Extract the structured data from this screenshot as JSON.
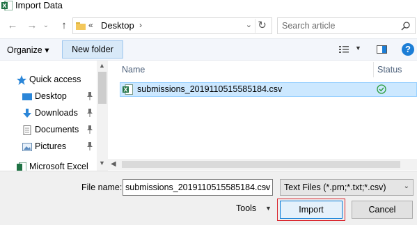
{
  "window": {
    "title": "Import Data",
    "app_icon": "excel-icon"
  },
  "nav": {
    "back_icon": "back-arrow-icon",
    "forward_icon": "forward-arrow-icon",
    "up_icon": "up-arrow-icon",
    "address": {
      "prefix": "«",
      "location": "Desktop",
      "chevron": "›"
    },
    "search_placeholder": "Search article"
  },
  "toolbar": {
    "organize_label": "Organize ▾",
    "new_folder_label": "New folder",
    "help_label": "?"
  },
  "sidebar": {
    "items": [
      {
        "label": "Quick access",
        "icon": "star-icon"
      },
      {
        "label": "Desktop",
        "icon": "desktop-icon",
        "pinned": true
      },
      {
        "label": "Downloads",
        "icon": "download-icon",
        "pinned": true
      },
      {
        "label": "Documents",
        "icon": "documents-icon",
        "pinned": true
      },
      {
        "label": "Pictures",
        "icon": "pictures-icon",
        "pinned": true
      },
      {
        "label": "Microsoft Excel",
        "icon": "excel-icon"
      }
    ]
  },
  "file_list": {
    "columns": [
      "Name",
      "Status"
    ],
    "rows": [
      {
        "name": "submissions_2019110515585184.csv",
        "status": "synced",
        "selected": true
      }
    ]
  },
  "footer": {
    "file_name_label": "File name:",
    "file_name_value": "submissions_2019110515585184.csv",
    "file_type_value": "Text Files (*.prn;*.txt;*.csv)",
    "tools_label": "Tools",
    "import_label": "Import",
    "cancel_label": "Cancel"
  },
  "colors": {
    "selection": "#cce8ff",
    "accent": "#0078d7",
    "highlight_outline": "#d9242b",
    "excel_green": "#1f7244"
  }
}
